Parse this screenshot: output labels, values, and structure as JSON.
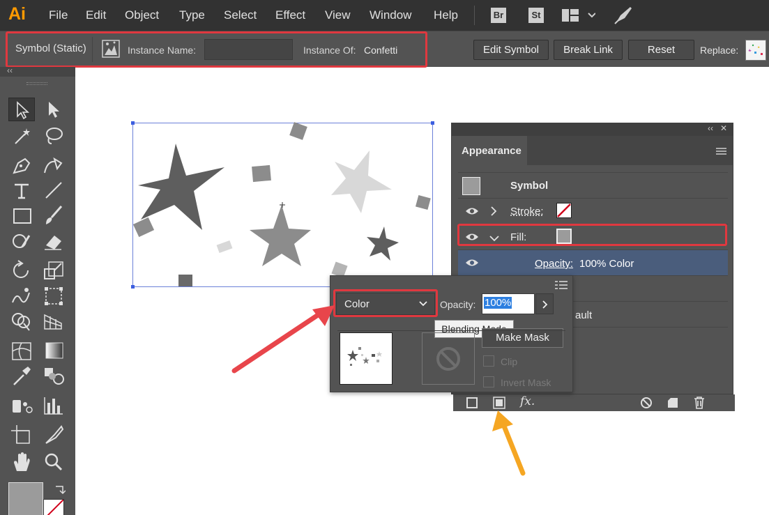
{
  "app": {
    "logo": "Ai"
  },
  "menu": [
    "File",
    "Edit",
    "Object",
    "Type",
    "Select",
    "Effect",
    "View",
    "Window",
    "Help"
  ],
  "bridge_labels": {
    "br": "Br",
    "st": "St"
  },
  "control_bar": {
    "symbol_type": "Symbol (Static)",
    "instance_name_label": "Instance Name:",
    "instance_name_value": "",
    "instance_of_label": "Instance Of:",
    "instance_of_value": "Confetti",
    "edit_symbol": "Edit Symbol",
    "break_link": "Break Link",
    "reset": "Reset",
    "replace_label": "Replace:"
  },
  "appearance_panel": {
    "title": "Appearance",
    "collapse_glyph": "‹‹",
    "close_glyph": "✕",
    "header": "Symbol",
    "stroke_label": "Stroke:",
    "fill_label": "Fill:",
    "opacity_label": "Opacity:",
    "opacity_value": "100% Color",
    "default_partial": "ault"
  },
  "transparency_panel": {
    "blend_mode": "Color",
    "opacity_label": "Opacity:",
    "opacity_value": "100%",
    "tooltip": "Blending Mode",
    "make_mask": "Make Mask",
    "clip": "Clip",
    "invert_mask": "Invert Mask"
  },
  "colors": {
    "highlight": "#e0383f",
    "arrow_red": "#e8454b",
    "arrow_orange": "#f5a623",
    "selected_row": "#4a5d7c",
    "logo": "#ff9a00"
  },
  "icons": [
    "eye-icon",
    "chevron-right-icon",
    "chevron-down-icon",
    "hamburger-menu-icon",
    "new-layer-icon",
    "duplicate-icon",
    "fx-icon",
    "clear-icon",
    "delete-icon"
  ]
}
